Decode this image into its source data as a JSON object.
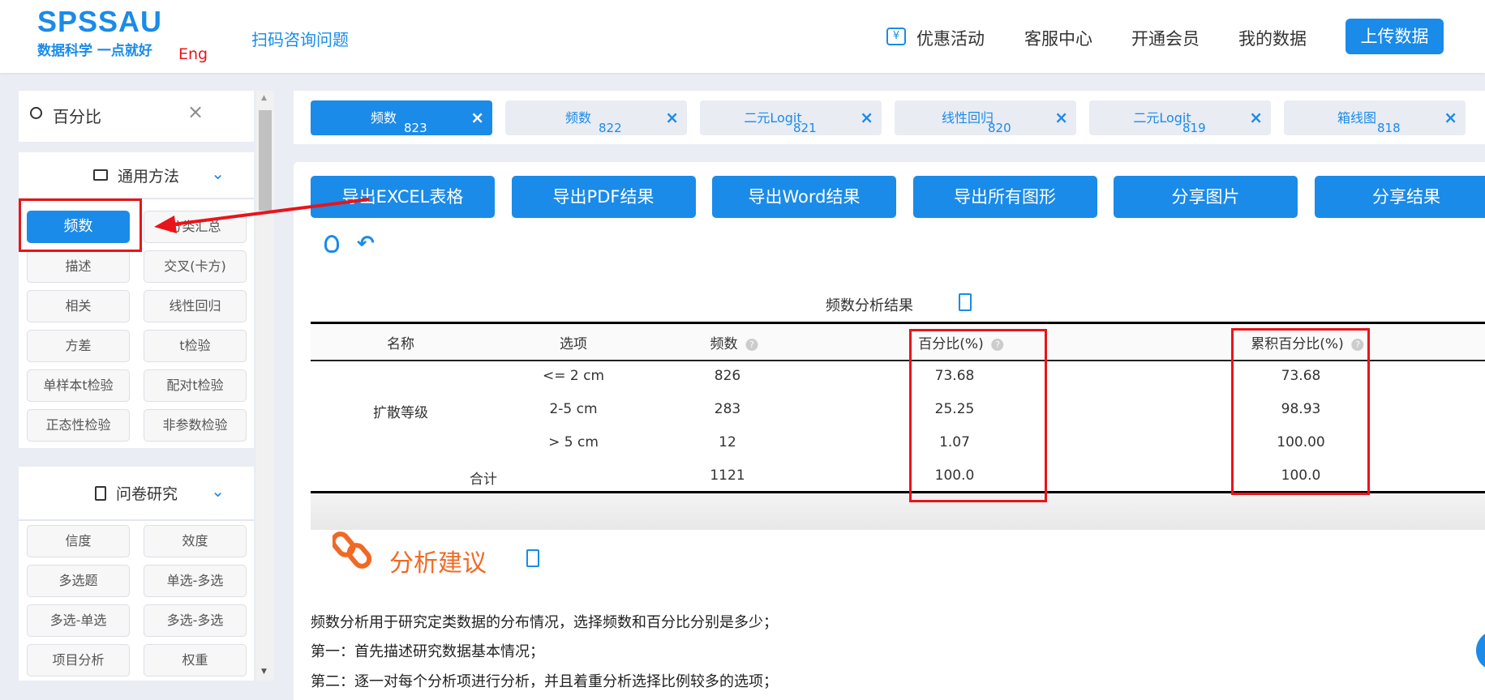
{
  "header": {
    "logo": "SPSSAU",
    "slogan": "数据科学 一点就好",
    "lang": "Eng",
    "scan": "扫码咨询问题",
    "nav": [
      "优惠活动",
      "客服中心",
      "开通会员",
      "我的数据"
    ],
    "upload": "上传数据"
  },
  "sidebar": {
    "search_value": "百分比",
    "cat1": {
      "title": "通用方法",
      "items": [
        "频数",
        "分类汇总",
        "描述",
        "交叉(卡方)",
        "相关",
        "线性回归",
        "方差",
        "t检验",
        "单样本t检验",
        "配对t检验",
        "正态性检验",
        "非参数检验"
      ]
    },
    "cat2": {
      "title": "问卷研究",
      "items": [
        "信度",
        "效度",
        "多选题",
        "单选-多选",
        "多选-单选",
        "多选-多选",
        "项目分析",
        "权重"
      ]
    }
  },
  "tabs": [
    {
      "label": "频数",
      "num": "823"
    },
    {
      "label": "频数",
      "num": "822"
    },
    {
      "label": "二元Logit",
      "num": "821"
    },
    {
      "label": "线性回归",
      "num": "820"
    },
    {
      "label": "二元Logit",
      "num": "819"
    },
    {
      "label": "箱线图",
      "num": "818"
    }
  ],
  "actions": [
    "导出EXCEL表格",
    "导出PDF结果",
    "导出Word结果",
    "导出所有图形",
    "分享图片",
    "分享结果"
  ],
  "table": {
    "title": "频数分析结果",
    "headers": [
      "名称",
      "选项",
      "频数",
      "百分比(%)",
      "累积百分比(%)"
    ],
    "name": "扩散等级",
    "rows": [
      [
        "<= 2 cm",
        "826",
        "73.68",
        "73.68"
      ],
      [
        "2-5 cm",
        "283",
        "25.25",
        "98.93"
      ],
      [
        "> 5 cm",
        "12",
        "1.07",
        "100.00"
      ]
    ],
    "total": {
      "label": "合计",
      "freq": "1121",
      "pct": "100.0",
      "cum": "100.0"
    }
  },
  "advice": {
    "title": "分析建议",
    "lines": [
      "频数分析用于研究定类数据的分布情况，选择频数和百分比分别是多少；",
      "第一：首先描述研究数据基本情况；",
      "第二：逐一对每个分析项进行分析，并且着重分析选择比例较多的选项；"
    ]
  },
  "colors": {
    "accent": "#1a8be8",
    "highlight": "#e8141a",
    "advice": "#f06a25"
  }
}
